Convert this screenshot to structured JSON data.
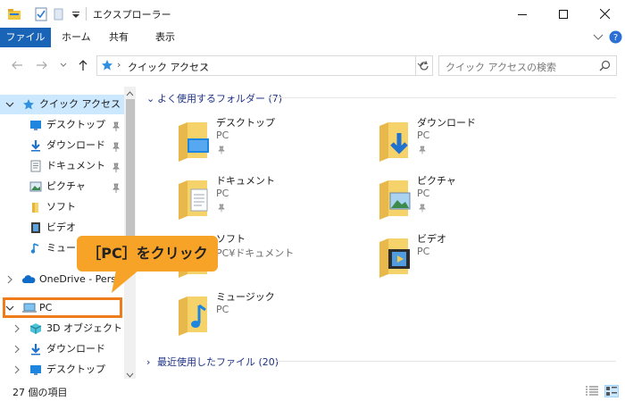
{
  "window": {
    "title": "エクスプローラー"
  },
  "ribbon": {
    "tabs": [
      "ファイル",
      "ホーム",
      "共有",
      "表示"
    ]
  },
  "address": {
    "path": "クイック アクセス",
    "search_placeholder": "クイック アクセスの検索"
  },
  "sidebar": {
    "quick_access": "クイック アクセス",
    "pinned": [
      {
        "label": "デスクトップ",
        "icon": "desktop-icon",
        "pinned": true
      },
      {
        "label": "ダウンロード",
        "icon": "download-icon",
        "pinned": true
      },
      {
        "label": "ドキュメント",
        "icon": "document-icon",
        "pinned": true
      },
      {
        "label": "ピクチャ",
        "icon": "picture-icon",
        "pinned": true
      },
      {
        "label": "ソフト",
        "icon": "folder-icon",
        "pinned": false
      },
      {
        "label": "ビデオ",
        "icon": "video-icon",
        "pinned": false
      },
      {
        "label": "ミュージ",
        "icon": "music-icon",
        "pinned": false
      }
    ],
    "onedrive": "OneDrive - Person",
    "pc": "PC",
    "pc_children": [
      {
        "label": "3D オブジェクト",
        "icon": "3d-objects-icon"
      },
      {
        "label": "ダウンロード",
        "icon": "download-icon"
      },
      {
        "label": "デスクトップ",
        "icon": "desktop-icon"
      }
    ]
  },
  "main": {
    "frequent_header": "よく使用するフォルダー (7)",
    "recent_header": "最近使用したファイル (20)",
    "folders": [
      {
        "name": "デスクトップ",
        "sub": "PC",
        "pinned": true,
        "overlay": "desktop"
      },
      {
        "name": "ダウンロード",
        "sub": "PC",
        "pinned": true,
        "overlay": "download"
      },
      {
        "name": "ドキュメント",
        "sub": "PC",
        "pinned": true,
        "overlay": "document"
      },
      {
        "name": "ピクチャ",
        "sub": "PC",
        "pinned": true,
        "overlay": "picture"
      },
      {
        "name": "ソフト",
        "sub": "PC¥ドキュメント",
        "pinned": false,
        "overlay": "none"
      },
      {
        "name": "ビデオ",
        "sub": "PC",
        "pinned": false,
        "overlay": "video"
      },
      {
        "name": "ミュージック",
        "sub": "PC",
        "pinned": false,
        "overlay": "music"
      }
    ]
  },
  "status": {
    "count": "27 個の項目"
  },
  "annotation": {
    "callout": "［PC］をクリック",
    "color": "#f7a328",
    "border_color": "#ee7c1b"
  }
}
